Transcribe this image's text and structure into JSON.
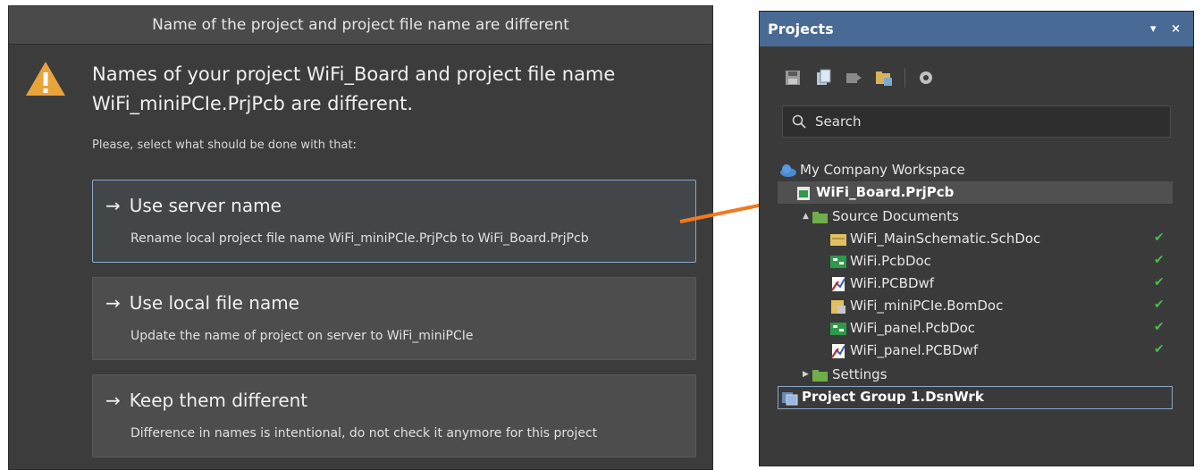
{
  "dialog": {
    "title": "Name of the project and project file name are different",
    "heading_line1": "Names of your project WiFi_Board and project file name",
    "heading_line2": "WiFi_miniPCIe.PrjPcb are different.",
    "prompt": "Please, select what should be done with that:",
    "options": [
      {
        "arrow": "→",
        "title": "Use server name",
        "description": "Rename local project file name WiFi_miniPCIe.PrjPcb to WiFi_Board.PrjPcb",
        "selected": true
      },
      {
        "arrow": "→",
        "title": "Use local file name",
        "description": "Update the name of project on server to WiFi_miniPCIe",
        "selected": false
      },
      {
        "arrow": "→",
        "title": "Keep them different",
        "description": "Difference in names is intentional, do not check it anymore for this project",
        "selected": false
      }
    ],
    "icon": "warning-icon"
  },
  "connector": {
    "color": "#f07a1e"
  },
  "panel": {
    "title": "Projects",
    "header_controls": {
      "menu": "▾",
      "close": "×"
    },
    "toolbar": [
      "save-icon",
      "open-project-icon",
      "close-icon",
      "folder-icon",
      "settings-icon"
    ],
    "search_placeholder": "Search",
    "tree": {
      "workspace": "My Company Workspace",
      "project": "WiFi_Board.PrjPcb",
      "folder_source": "Source Documents",
      "docs": [
        {
          "name": "WiFi_MainSchematic.SchDoc",
          "icon": "schematic-doc-icon"
        },
        {
          "name": "WiFi.PcbDoc",
          "icon": "pcb-doc-icon"
        },
        {
          "name": "WiFi.PCBDwf",
          "icon": "draftsman-doc-icon"
        },
        {
          "name": "WiFi_miniPCIe.BomDoc",
          "icon": "bom-doc-icon"
        },
        {
          "name": "WiFi_panel.PcbDoc",
          "icon": "pcb-doc-icon"
        },
        {
          "name": "WiFi_panel.PCBDwf",
          "icon": "draftsman-doc-icon"
        }
      ],
      "folder_settings": "Settings",
      "project_group": "Project Group 1.DsnWrk"
    },
    "check_color": "#4fb84f"
  }
}
